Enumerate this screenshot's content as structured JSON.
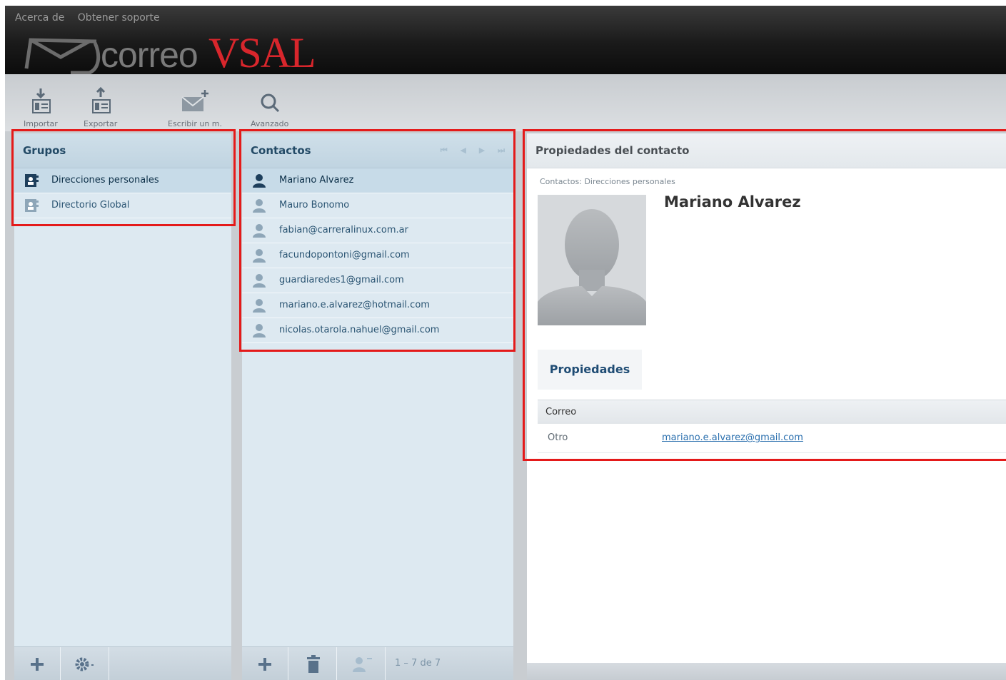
{
  "header": {
    "nav_about": "Acerca de",
    "nav_support": "Obtener soporte",
    "logo_word1": "correo",
    "logo_word2": "VSAL"
  },
  "toolbar": {
    "import_label": "Importar",
    "export_label": "Exportar",
    "compose_label": "Escribir un m.",
    "advanced_label": "Avanzado"
  },
  "groups": {
    "title": "Grupos",
    "items": [
      {
        "label": "Direcciones personales",
        "selected": true
      },
      {
        "label": "Directorio Global",
        "selected": false
      }
    ]
  },
  "contacts": {
    "title": "Contactos",
    "items": [
      {
        "label": "Mariano Alvarez",
        "selected": true
      },
      {
        "label": "Mauro Bonomo",
        "selected": false
      },
      {
        "label": "fabian@carreralinux.com.ar",
        "selected": false
      },
      {
        "label": "facundopontoni@gmail.com",
        "selected": false
      },
      {
        "label": "guardiaredes1@gmail.com",
        "selected": false
      },
      {
        "label": "mariano.e.alvarez@hotmail.com",
        "selected": false
      },
      {
        "label": "nicolas.otarola.nahuel@gmail.com",
        "selected": false
      }
    ],
    "count": "1 – 7 de 7"
  },
  "details": {
    "title": "Propiedades del contacto",
    "breadcrumb": "Contactos: Direcciones personales",
    "name": "Mariano Alvarez",
    "tab_properties": "Propiedades",
    "section_email": "Correo",
    "email_type": "Otro",
    "email_value": "mariano.e.alvarez@gmail.com"
  },
  "colors": {
    "brand_red": "#d8262c",
    "highlight_red": "#e41a1a",
    "panel_blue": "#dde9f1"
  }
}
